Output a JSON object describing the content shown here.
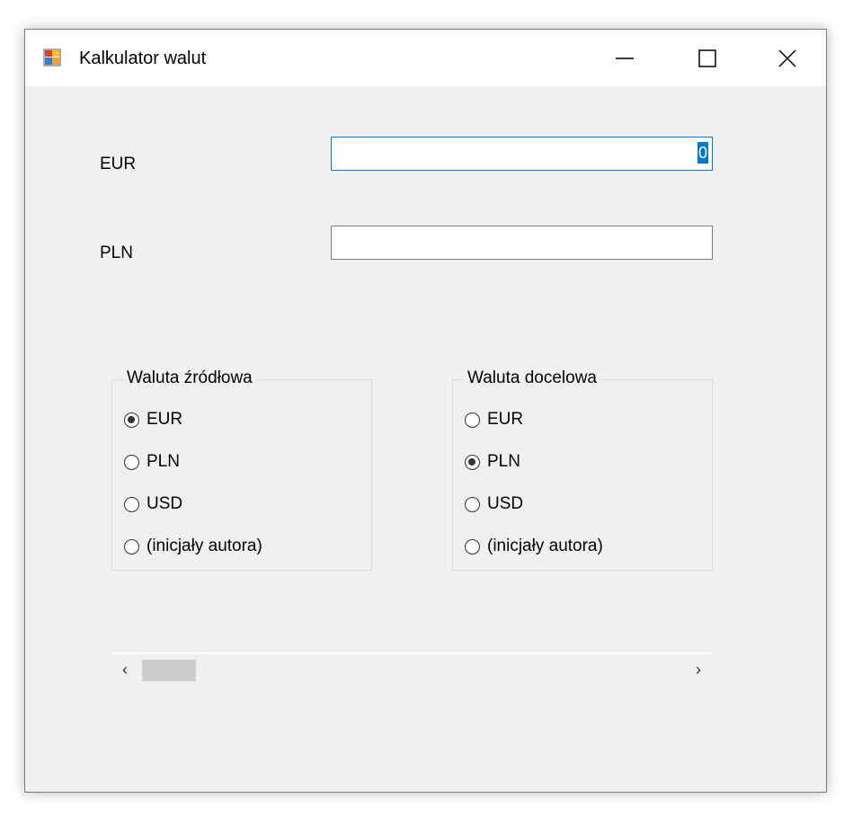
{
  "window": {
    "title": "Kalkulator walut",
    "icon": "form-icon",
    "buttons": [
      "minimize",
      "maximize",
      "close"
    ]
  },
  "fields": {
    "eur_label": "EUR",
    "eur_value": "0",
    "pln_label": "PLN",
    "pln_value": ""
  },
  "source_group": {
    "title": "Waluta źródłowa",
    "options": [
      {
        "label": "EUR",
        "checked": true
      },
      {
        "label": "PLN",
        "checked": false
      },
      {
        "label": "USD",
        "checked": false
      },
      {
        "label": "(inicjały autora)",
        "checked": false
      }
    ]
  },
  "target_group": {
    "title": "Waluta docelowa",
    "options": [
      {
        "label": "EUR",
        "checked": false
      },
      {
        "label": "PLN",
        "checked": true
      },
      {
        "label": "USD",
        "checked": false
      },
      {
        "label": "(inicjały autora)",
        "checked": false
      }
    ]
  },
  "scrollbar": {
    "left_arrow": "‹",
    "right_arrow": "›",
    "position_fraction": 0.0
  }
}
